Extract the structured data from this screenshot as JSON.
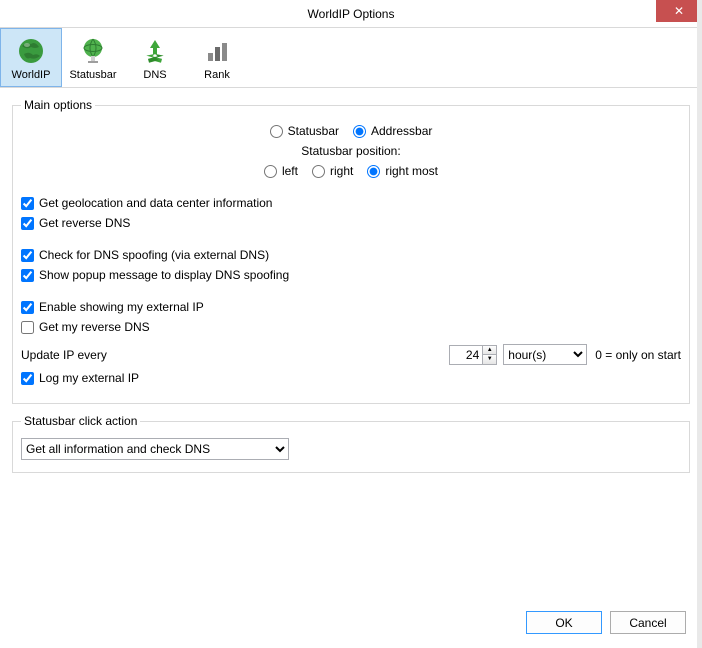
{
  "window": {
    "title": "WorldIP Options",
    "close_glyph": "✕"
  },
  "tabs": [
    {
      "label": "WorldIP"
    },
    {
      "label": "Statusbar"
    },
    {
      "label": "DNS"
    },
    {
      "label": "Rank"
    }
  ],
  "main_options": {
    "legend": "Main options",
    "placement": {
      "statusbar": "Statusbar",
      "addressbar": "Addressbar"
    },
    "position_label": "Statusbar position:",
    "positions": {
      "left": "left",
      "right": "right",
      "right_most": "right most"
    },
    "checks": {
      "get_geo": "Get geolocation and data center information",
      "get_rev_dns": "Get reverse DNS",
      "check_spoof": "Check for DNS spoofing (via external DNS)",
      "show_popup": "Show popup message to display DNS spoofing",
      "enable_ext_ip": "Enable showing my external IP",
      "get_my_rev_dns": "Get my reverse DNS",
      "log_ext_ip": "Log my external IP"
    },
    "update": {
      "label": "Update IP every",
      "value": "24",
      "unit_options": [
        "hour(s)"
      ],
      "unit_selected": "hour(s)",
      "hint": "0 = only on start"
    }
  },
  "click_action": {
    "legend": "Statusbar click action",
    "selected": "Get all information and check DNS",
    "options": [
      "Get all information and check DNS"
    ]
  },
  "buttons": {
    "ok": "OK",
    "cancel": "Cancel"
  }
}
